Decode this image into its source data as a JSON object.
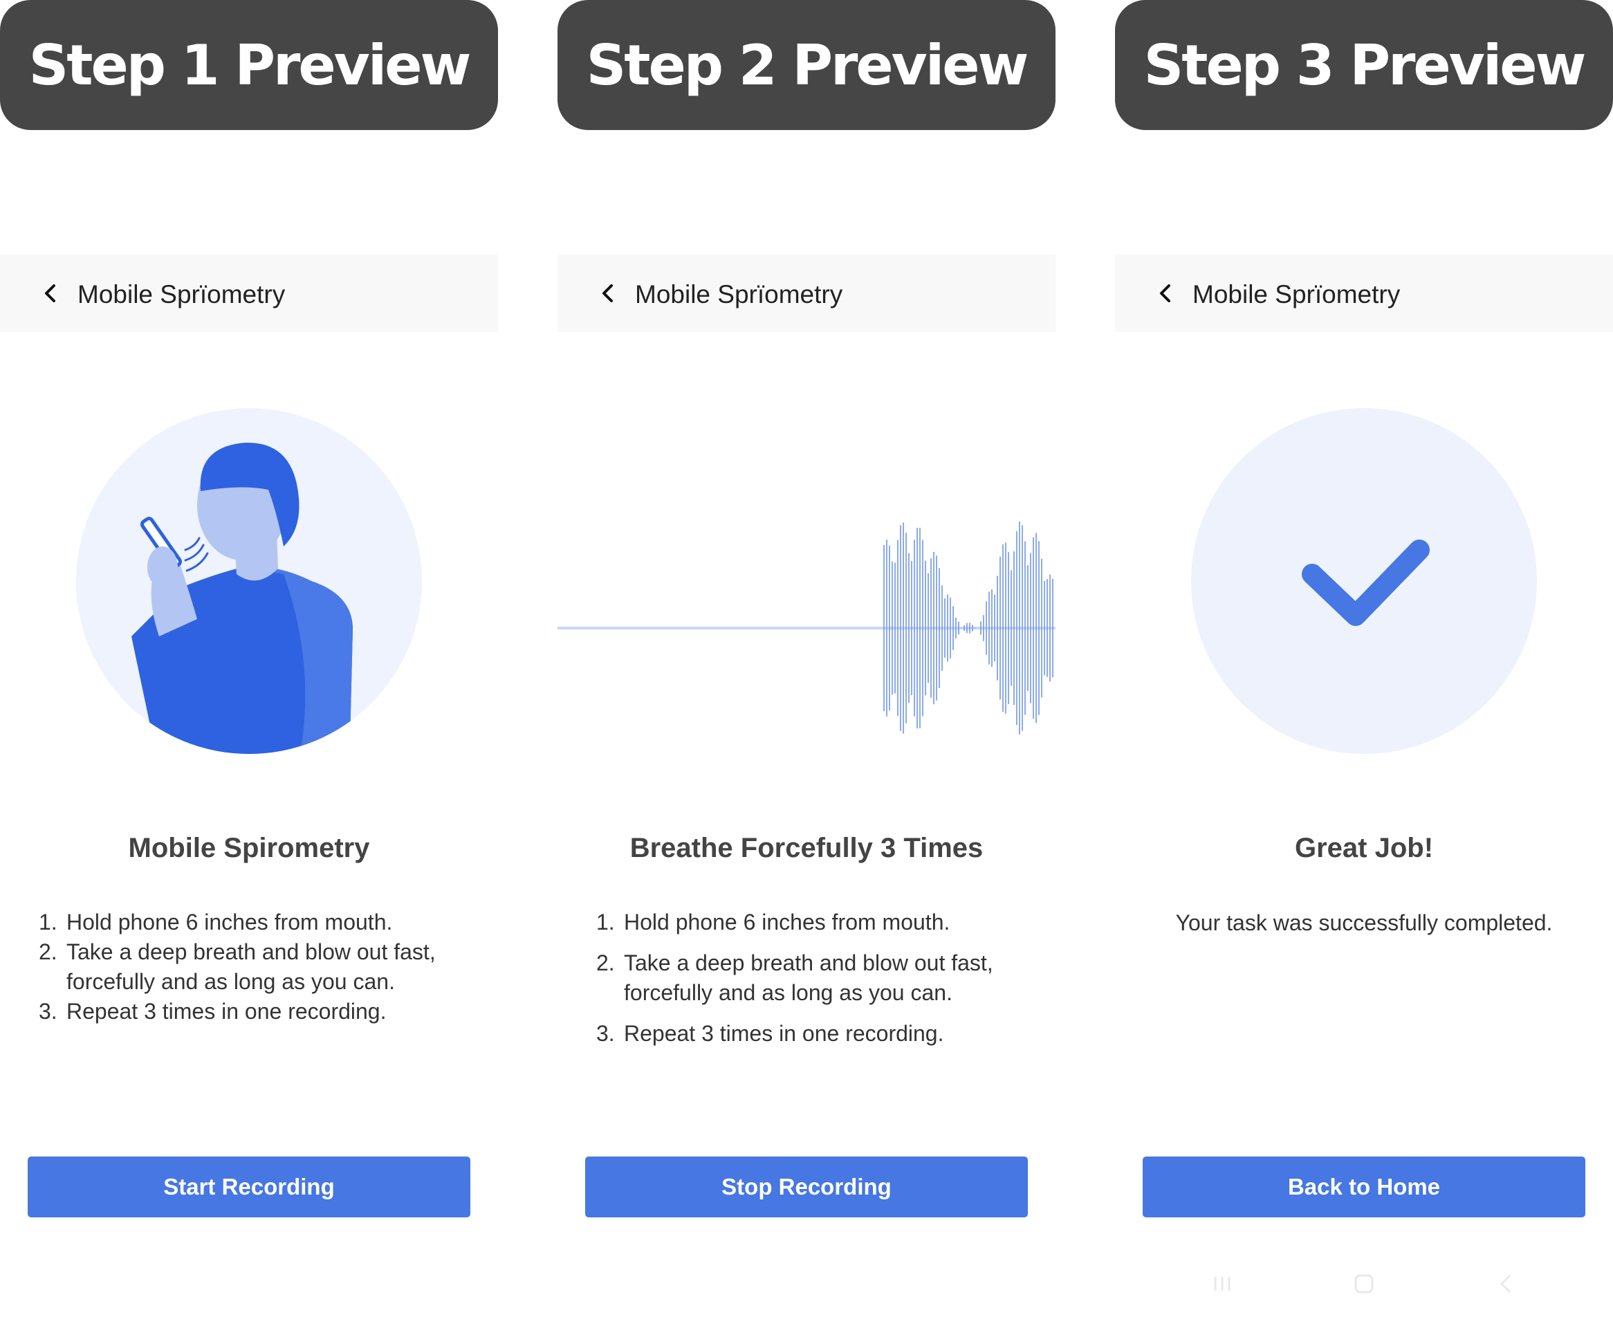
{
  "colors": {
    "header_bg": "#464646",
    "appbar_bg": "#f8f8f8",
    "primary": "#4677e2",
    "illustration_bg": "#eef3fd"
  },
  "panels": [
    {
      "header": "Step 1 Preview",
      "appbar_title": "Mobile Sprïometry",
      "heading": "Mobile Spirometry",
      "instructions": [
        {
          "num": "1.",
          "text": "Hold phone 6 inches from mouth."
        },
        {
          "num": "2.",
          "text": "Take a deep breath and blow out fast, forcefully and as long as you can."
        },
        {
          "num": "3.",
          "text": "Repeat 3 times in one recording."
        }
      ],
      "button": "Start Recording",
      "illustration": "person-blowing-into-phone"
    },
    {
      "header": "Step 2 Preview",
      "appbar_title": "Mobile Sprïometry",
      "heading": "Breathe Forcefully 3 Times",
      "instructions": [
        {
          "num": "1.",
          "text": "Hold phone 6 inches from mouth."
        },
        {
          "num": "2.",
          "text": "Take a deep breath and blow out fast, forcefully and as long as you can."
        },
        {
          "num": "3.",
          "text": "Repeat 3 times in one recording."
        }
      ],
      "button": "Stop Recording",
      "illustration": "audio-waveform"
    },
    {
      "header": "Step 3 Preview",
      "appbar_title": "Mobile Sprïometry",
      "heading": "Great Job!",
      "message": "Your task was successfully completed.",
      "button": "Back to Home",
      "illustration": "checkmark"
    }
  ]
}
